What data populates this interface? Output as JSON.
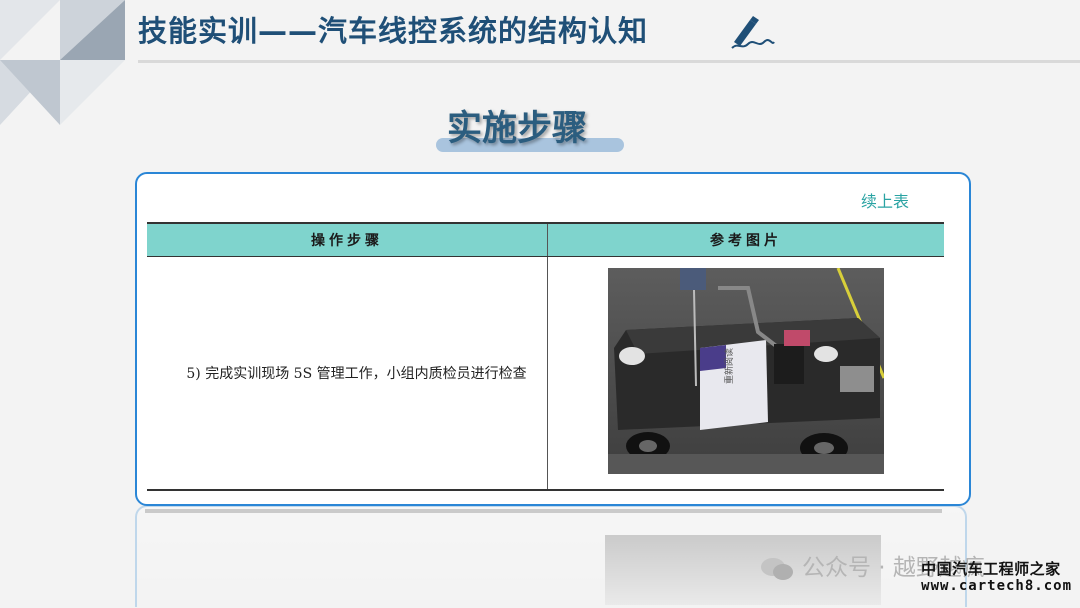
{
  "header": {
    "title": "技能实训——汽车线控系统的结构认知",
    "subtitle": "实施步骤"
  },
  "table": {
    "continued_label": "续上表",
    "columns": [
      "操作步骤",
      "参考图片"
    ],
    "rows": [
      {
        "step": "5) 完成实训现场 5S 管理工作，小组内质检员进行检查"
      }
    ]
  },
  "photo": {
    "sign_text": "重新阅读"
  },
  "watermarks": {
    "wechat": "公众号 · 越野越疯",
    "site_cn": "中国汽车工程师之家",
    "site_url": "www.cartech8.com"
  },
  "colors": {
    "title": "#1f4f77",
    "accent_border": "#2a86d6",
    "table_header": "#7fd4cd",
    "continued_label": "#2aa3a3"
  }
}
